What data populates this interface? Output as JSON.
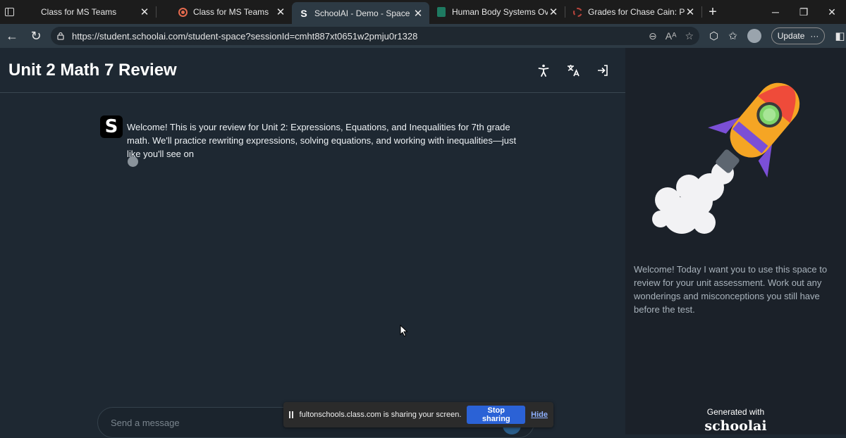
{
  "browser": {
    "tabs": [
      {
        "label": "Class for MS Teams",
        "icon": "teams-icon",
        "active": false
      },
      {
        "label": "Class for MS Teams",
        "icon": "recording-icon",
        "active": false
      },
      {
        "label": "SchoolAI - Demo - Space",
        "icon": "schoolai-icon",
        "active": true
      },
      {
        "label": "Human Body Systems Overvie",
        "icon": "slides-icon",
        "active": false
      },
      {
        "label": "Grades for Chase Cain: Period",
        "icon": "grades-icon",
        "active": false
      }
    ],
    "url": "https://student.schoolai.com/student-space?sessionId=cmht887xt0651w2pmju0r1328",
    "update_label": "Update"
  },
  "main": {
    "title": "Unit 2 Math 7 Review",
    "bot_logo_letter": "S",
    "message": "Welcome! This is your review for Unit 2: Expressions, Equations, and Inequalities for 7th grade math. We'll practice rewriting expressions, solving equations, and working with inequalities—just like you'll see on",
    "composer_placeholder": "Send a message"
  },
  "sidebar": {
    "description": "Welcome! Today I want you to use this space to review for your unit assessment. Work out any wonderings and misconceptions you still have before the test.",
    "generated_with": "Generated with",
    "brand": "schoolai"
  },
  "sharebar": {
    "text": "fultonschools.class.com is sharing your screen.",
    "stop_label": "Stop sharing",
    "hide_label": "Hide"
  },
  "colors": {
    "main_bg": "#1e2832",
    "sidebar_bg": "#1b2129",
    "stop_button": "#2b62d6"
  }
}
